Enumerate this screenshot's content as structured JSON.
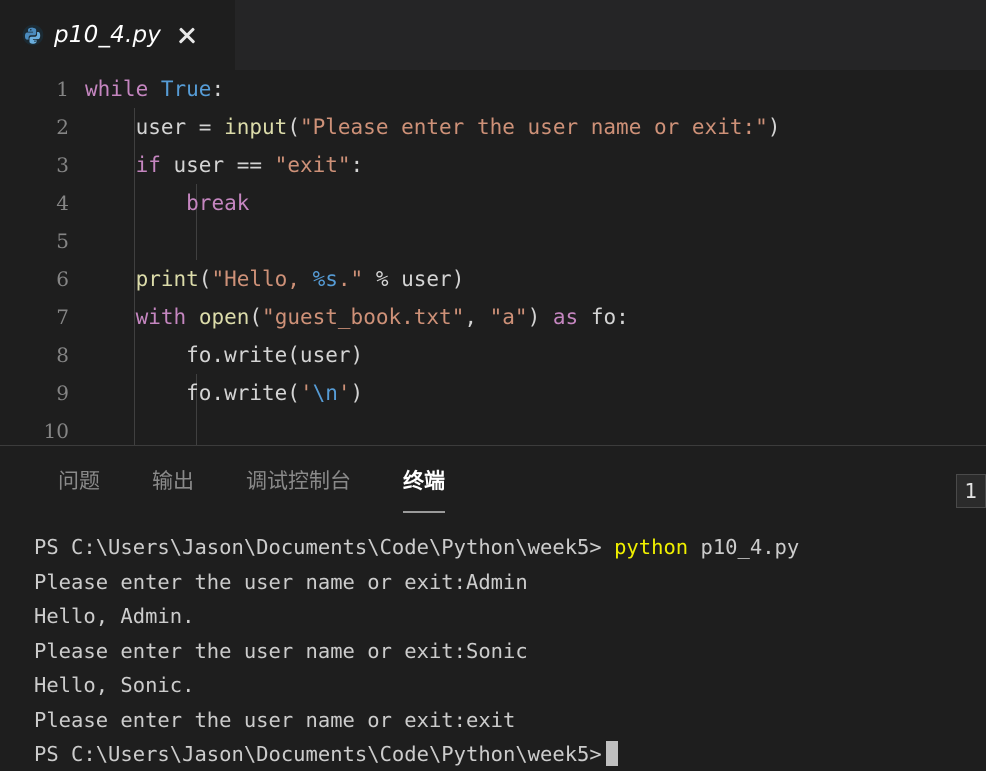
{
  "window": {
    "background": "#1e1e1e"
  },
  "tabbar": {
    "tab": {
      "icon": "python-file-icon",
      "filename": "p10_4.py",
      "close_label": "×",
      "active": true
    }
  },
  "editor": {
    "language": "python",
    "line_numbers": [
      "1",
      "2",
      "3",
      "4",
      "5",
      "6",
      "7",
      "8",
      "9",
      "10"
    ],
    "lines": [
      {
        "number": "1",
        "text": "while True:",
        "tokens": [
          {
            "t": "while",
            "c": "kw"
          },
          {
            "t": " ",
            "c": "plain"
          },
          {
            "t": "True",
            "c": "bool"
          },
          {
            "t": ":",
            "c": "plain"
          }
        ]
      },
      {
        "number": "2",
        "text": "    user = input(\"Please enter the user name or exit:\")",
        "tokens": [
          {
            "t": "    ",
            "c": "plain"
          },
          {
            "t": "user",
            "c": "plain"
          },
          {
            "t": " = ",
            "c": "plain"
          },
          {
            "t": "input",
            "c": "fn"
          },
          {
            "t": "(",
            "c": "plain"
          },
          {
            "t": "\"Please enter the user name or exit:\"",
            "c": "str"
          },
          {
            "t": ")",
            "c": "plain"
          }
        ]
      },
      {
        "number": "3",
        "text": "    if user == \"exit\":",
        "tokens": [
          {
            "t": "    ",
            "c": "plain"
          },
          {
            "t": "if",
            "c": "ctl"
          },
          {
            "t": " user == ",
            "c": "plain"
          },
          {
            "t": "\"exit\"",
            "c": "str"
          },
          {
            "t": ":",
            "c": "plain"
          }
        ]
      },
      {
        "number": "4",
        "text": "        break",
        "tokens": [
          {
            "t": "        ",
            "c": "plain"
          },
          {
            "t": "break",
            "c": "ctl"
          }
        ]
      },
      {
        "number": "5",
        "text": "",
        "tokens": []
      },
      {
        "number": "6",
        "text": "    print(\"Hello, %s.\" % user)",
        "tokens": [
          {
            "t": "    ",
            "c": "plain"
          },
          {
            "t": "print",
            "c": "fn"
          },
          {
            "t": "(",
            "c": "plain"
          },
          {
            "t": "\"Hello, ",
            "c": "str"
          },
          {
            "t": "%s",
            "c": "fmt"
          },
          {
            "t": ".\"",
            "c": "str"
          },
          {
            "t": " % user)",
            "c": "plain"
          }
        ]
      },
      {
        "number": "7",
        "text": "    with open(\"guest_book.txt\", \"a\") as fo:",
        "tokens": [
          {
            "t": "    ",
            "c": "plain"
          },
          {
            "t": "with",
            "c": "kw"
          },
          {
            "t": " ",
            "c": "plain"
          },
          {
            "t": "open",
            "c": "fn"
          },
          {
            "t": "(",
            "c": "plain"
          },
          {
            "t": "\"guest_book.txt\"",
            "c": "str"
          },
          {
            "t": ", ",
            "c": "plain"
          },
          {
            "t": "\"a\"",
            "c": "str"
          },
          {
            "t": ") ",
            "c": "plain"
          },
          {
            "t": "as",
            "c": "kw"
          },
          {
            "t": " fo:",
            "c": "plain"
          }
        ]
      },
      {
        "number": "8",
        "text": "        fo.write(user)",
        "tokens": [
          {
            "t": "        fo.write(user)",
            "c": "plain"
          }
        ]
      },
      {
        "number": "9",
        "text": "        fo.write('\\n')",
        "tokens": [
          {
            "t": "        fo.write(",
            "c": "plain"
          },
          {
            "t": "'",
            "c": "str"
          },
          {
            "t": "\\n",
            "c": "fmt"
          },
          {
            "t": "'",
            "c": "str"
          },
          {
            "t": ")",
            "c": "plain"
          }
        ]
      },
      {
        "number": "10",
        "text": "",
        "tokens": []
      }
    ]
  },
  "panel": {
    "tabs": [
      {
        "label": "问题",
        "active": false
      },
      {
        "label": "输出",
        "active": false
      },
      {
        "label": "调试控制台",
        "active": false
      },
      {
        "label": "终端",
        "active": true
      }
    ],
    "terminal_count": "1",
    "terminal": {
      "lines": [
        {
          "type": "command",
          "prompt": "PS C:\\Users\\Jason\\Documents\\Code\\Python\\week5> ",
          "command": "python",
          "args": " p10_4.py"
        },
        {
          "type": "output",
          "text": "Please enter the user name or exit:Admin"
        },
        {
          "type": "output",
          "text": "Hello, Admin."
        },
        {
          "type": "output",
          "text": "Please enter the user name or exit:Sonic"
        },
        {
          "type": "output",
          "text": "Hello, Sonic."
        },
        {
          "type": "output",
          "text": "Please enter the user name or exit:exit"
        },
        {
          "type": "prompt",
          "prompt": "PS C:\\Users\\Jason\\Documents\\Code\\Python\\week5>",
          "cursor": true
        }
      ]
    }
  },
  "colors": {
    "editor_background": "#1e1e1e",
    "tabbar_background": "#252526",
    "keyword": "#c586c0",
    "boolean": "#569cd6",
    "function": "#dcdcaa",
    "string": "#ce9178",
    "format_specifier": "#569cd6",
    "foreground": "#d4d4d4",
    "line_number": "#858585",
    "terminal_command": "#f0f000",
    "terminal_text": "#cccccc"
  }
}
